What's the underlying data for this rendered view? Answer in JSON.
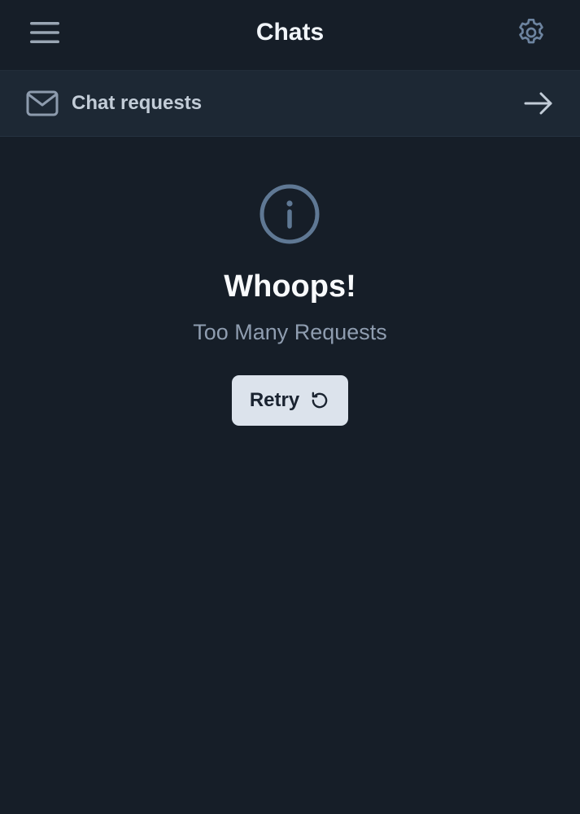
{
  "header": {
    "title": "Chats",
    "menu_icon": "hamburger-menu-icon",
    "settings_icon": "gear-icon"
  },
  "chat_requests": {
    "label": "Chat requests",
    "icon": "mail-icon",
    "arrow_icon": "arrow-right-icon"
  },
  "error": {
    "icon": "info-icon",
    "heading": "Whoops!",
    "message": "Too Many Requests",
    "retry_label": "Retry",
    "retry_icon": "refresh-icon"
  },
  "colors": {
    "background": "#161e28",
    "bar_background": "#1d2834",
    "icon_accent": "#5f7894",
    "button_background": "#dce3ec"
  }
}
